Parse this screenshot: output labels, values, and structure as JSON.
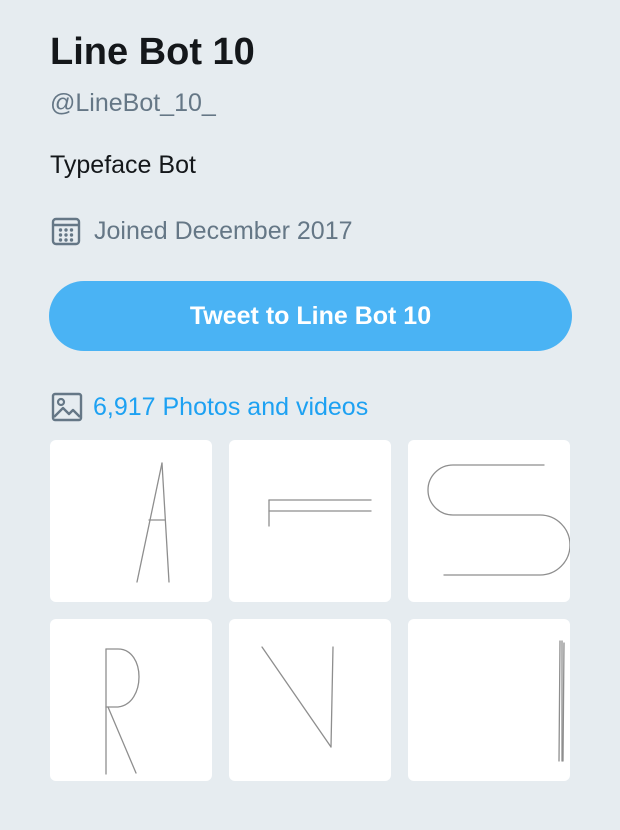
{
  "profile": {
    "name": "Line Bot 10",
    "handle": "@LineBot_10_",
    "bio": "Typeface Bot",
    "joined": "Joined December 2017",
    "tweet_button_label": "Tweet to Line Bot 10",
    "media_link_label": "6,917 Photos and videos"
  },
  "icons": {
    "joined": "calendar-icon",
    "media": "image-icon"
  },
  "colors": {
    "background": "#e6ecf0",
    "accent_button": "#4ab3f4",
    "link": "#1da1f2",
    "secondary_text": "#657786",
    "primary_text": "#14171a"
  },
  "media_tiles": [
    {
      "glyph": "A"
    },
    {
      "glyph": "F"
    },
    {
      "glyph": "S"
    },
    {
      "glyph": "R"
    },
    {
      "glyph": "N"
    },
    {
      "glyph": "I"
    }
  ]
}
